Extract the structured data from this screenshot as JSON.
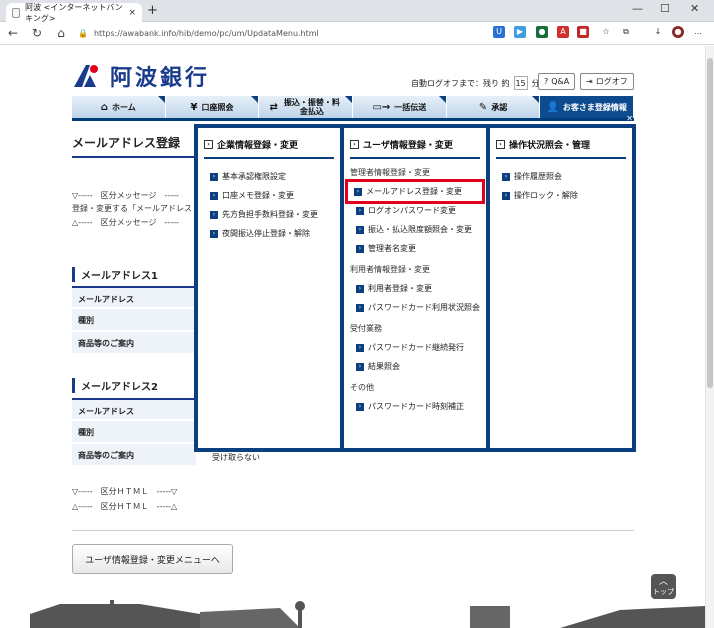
{
  "browser": {
    "tab_title": "阿波 <インターネットバンキング>",
    "url": "https://awabank.info/hib/demo/pc/um/UpdataMenu.html"
  },
  "header": {
    "logo_text": "阿波銀行",
    "autologoff_label": "自動ログオフまで：残り 約",
    "autologoff_count": "15",
    "autologoff_unit": "分",
    "qa_label": "Q&A",
    "logoff_label": "ログオフ"
  },
  "gnav": [
    {
      "label": "ホーム"
    },
    {
      "label": "口座照会"
    },
    {
      "label": "振込・振替・料金払込"
    },
    {
      "label": "一括伝送"
    },
    {
      "label": "承認"
    },
    {
      "label": "お客さま登録情報"
    }
  ],
  "main": {
    "title": "メールアドレス登録",
    "msg1": "▽-----　区分メッセージ　-----",
    "msg2": "登録・変更する「メールアドレス",
    "msg3": "△-----　区分メッセージ　-----",
    "section1": "メールアドレス1",
    "section2": "メールアドレス2",
    "row_email": "メールアドレス",
    "row_type": "種別",
    "row_info": "商品等のご案内",
    "info_value": "受け取らない",
    "html1": "▽-----　区分ＨＴＭＬ　-----▽",
    "html2": "△-----　区分ＨＴＭＬ　-----△",
    "back_button": "ユーザ情報登録・変更メニューへ",
    "top_label": "トップ"
  },
  "mega": {
    "col1": {
      "title": "企業情報登録・変更",
      "items": [
        "基本承認権限設定",
        "口座メモ登録・変更",
        "先方負担手数料登録・変更",
        "夜間振込停止登録・解除"
      ]
    },
    "col2": {
      "title": "ユーザ情報登録・変更",
      "group1": "管理者情報登録・変更",
      "group1_items": [
        "メールアドレス登録・変更",
        "ログオンパスワード変更",
        "振込・払込限度額照会・変更",
        "管理者名変更"
      ],
      "group2": "利用者情報登録・変更",
      "group2_items": [
        "利用者登録・変更",
        "パスワードカード利用状況照会"
      ],
      "group3": "受付業務",
      "group3_items": [
        "パスワードカード継続発行",
        "結果照会"
      ],
      "group4": "その他",
      "group4_items": [
        "パスワードカード時刻補正"
      ]
    },
    "col3": {
      "title": "操作状況照会・管理",
      "items": [
        "操作履歴照会",
        "操作ロック・解除"
      ]
    }
  }
}
